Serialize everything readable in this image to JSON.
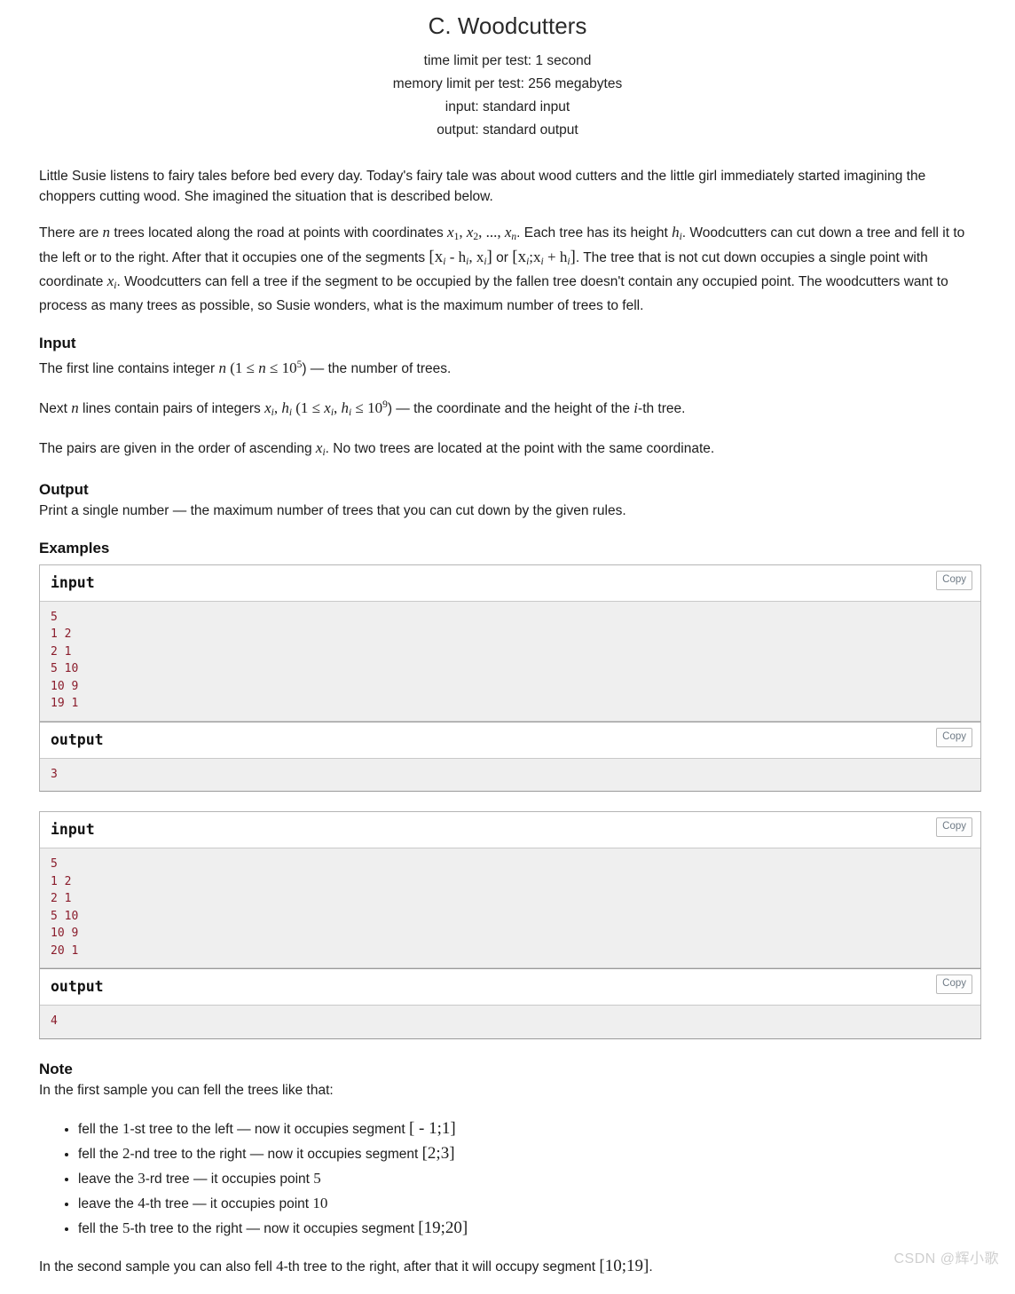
{
  "header": {
    "title": "C. Woodcutters",
    "time_limit": "time limit per test: 1 second",
    "memory_limit": "memory limit per test: 256 megabytes",
    "input_spec": "input: standard input",
    "output_spec": "output: standard output"
  },
  "statement": {
    "p1": "Little Susie listens to fairy tales before bed every day. Today's fairy tale was about wood cutters and the little girl immediately started imagining the choppers cutting wood. She imagined the situation that is described below.",
    "p2_a": "There are ",
    "p2_n": "n",
    "p2_b": " trees located along the road at points with coordinates ",
    "p2_x1": "x",
    "p2_x1s": "1",
    "p2_c": ", ",
    "p2_x2": "x",
    "p2_x2s": "2",
    "p2_d": ", ..., ",
    "p2_xn": "x",
    "p2_xns": "n",
    "p2_e": ". Each tree has its height ",
    "p2_h": "h",
    "p2_hs": "i",
    "p2_f": ". Woodcutters can cut down a tree and fell it to the left or to the right. After that it occupies one of the segments ",
    "p2_seg1": "[x",
    "p2_seg1s": "i",
    "p2_seg1b": " - h",
    "p2_seg1bs": "i",
    "p2_seg1c": ", x",
    "p2_seg1cs": "i",
    "p2_seg1d": "]",
    "p2_or": " or ",
    "p2_seg2": "[x",
    "p2_seg2s": "i",
    "p2_seg2b": ";x",
    "p2_seg2bs": "i",
    "p2_seg2c": " + h",
    "p2_seg2cs": "i",
    "p2_seg2d": "]",
    "p2_g": ". The tree that is not cut down occupies a single point with coordinate ",
    "p2_xi": "x",
    "p2_xis": "i",
    "p2_h2": ". Woodcutters can fell a tree if the segment to be occupied by the fallen tree doesn't contain any occupied point. The woodcutters want to process as many trees as possible, so Susie wonders, what is the maximum number of trees to fell."
  },
  "input_section": {
    "heading": "Input",
    "l1_a": "The first line contains integer ",
    "l1_n": "n",
    "l1_b": " (1 ",
    "l1_le1": "≤",
    "l1_n2": " n ",
    "l1_le2": "≤",
    "l1_pow": " 10",
    "l1_powsup": "5",
    "l1_c": ") — the number of trees.",
    "l2_a": "Next ",
    "l2_n": "n",
    "l2_b": " lines contain pairs of integers ",
    "l2_x": "x",
    "l2_xs": "i",
    "l2_c": ", ",
    "l2_h": "h",
    "l2_hs": "i",
    "l2_d": " (1 ",
    "l2_le1": "≤",
    "l2_x2": " x",
    "l2_x2s": "i",
    "l2_e": ", ",
    "l2_h2": "h",
    "l2_h2s": "i",
    "l2_le2": " ≤",
    "l2_pow": " 10",
    "l2_powsup": "9",
    "l2_f": ") — the coordinate and the height of the ",
    "l2_i": "i",
    "l2_g": "-th tree.",
    "l3_a": "The pairs are given in the order of ascending ",
    "l3_x": "x",
    "l3_xs": "i",
    "l3_b": ". No two trees are located at the point with the same coordinate."
  },
  "output_section": {
    "heading": "Output",
    "text": "Print a single number — the maximum number of trees that you can cut down by the given rules."
  },
  "examples": {
    "heading": "Examples",
    "copy_label": "Copy",
    "input_label": "input",
    "output_label": "output",
    "tests": [
      {
        "input": "5\n1 2\n2 1\n5 10\n10 9\n19 1",
        "output": "3"
      },
      {
        "input": "5\n1 2\n2 1\n5 10\n10 9\n20 1",
        "output": "4"
      }
    ]
  },
  "note_section": {
    "heading": "Note",
    "intro": "In the first sample you can fell the trees like that:",
    "bullets": [
      {
        "a": "fell the ",
        "num": "1",
        "b": "-st tree to the left — now it occupies segment ",
        "seg": "[ - 1;1]"
      },
      {
        "a": "fell the ",
        "num": "2",
        "b": "-nd tree to the right — now it occupies segment ",
        "seg": "[2;3]"
      },
      {
        "a": "leave the ",
        "num": "3",
        "b": "-rd tree — it occupies point ",
        "seg": "5"
      },
      {
        "a": "leave the ",
        "num": "4",
        "b": "-th tree — it occupies point ",
        "seg": "10"
      },
      {
        "a": "fell the ",
        "num": "5",
        "b": "-th tree to the right — now it occupies segment ",
        "seg": "[19;20]"
      }
    ],
    "closing_a": "In the second sample you can also fell ",
    "closing_num": "4",
    "closing_b": "-th tree to the right, after that it will occupy segment ",
    "closing_seg": "[10;19]",
    "closing_c": "."
  },
  "watermark": {
    "text": "CSDN @辉小歌"
  },
  "colors": {
    "sample_text": "#8a1c2b",
    "sample_bg": "#efefef",
    "copy_text": "#6f7b86",
    "watermark": "#cfcfcf"
  }
}
